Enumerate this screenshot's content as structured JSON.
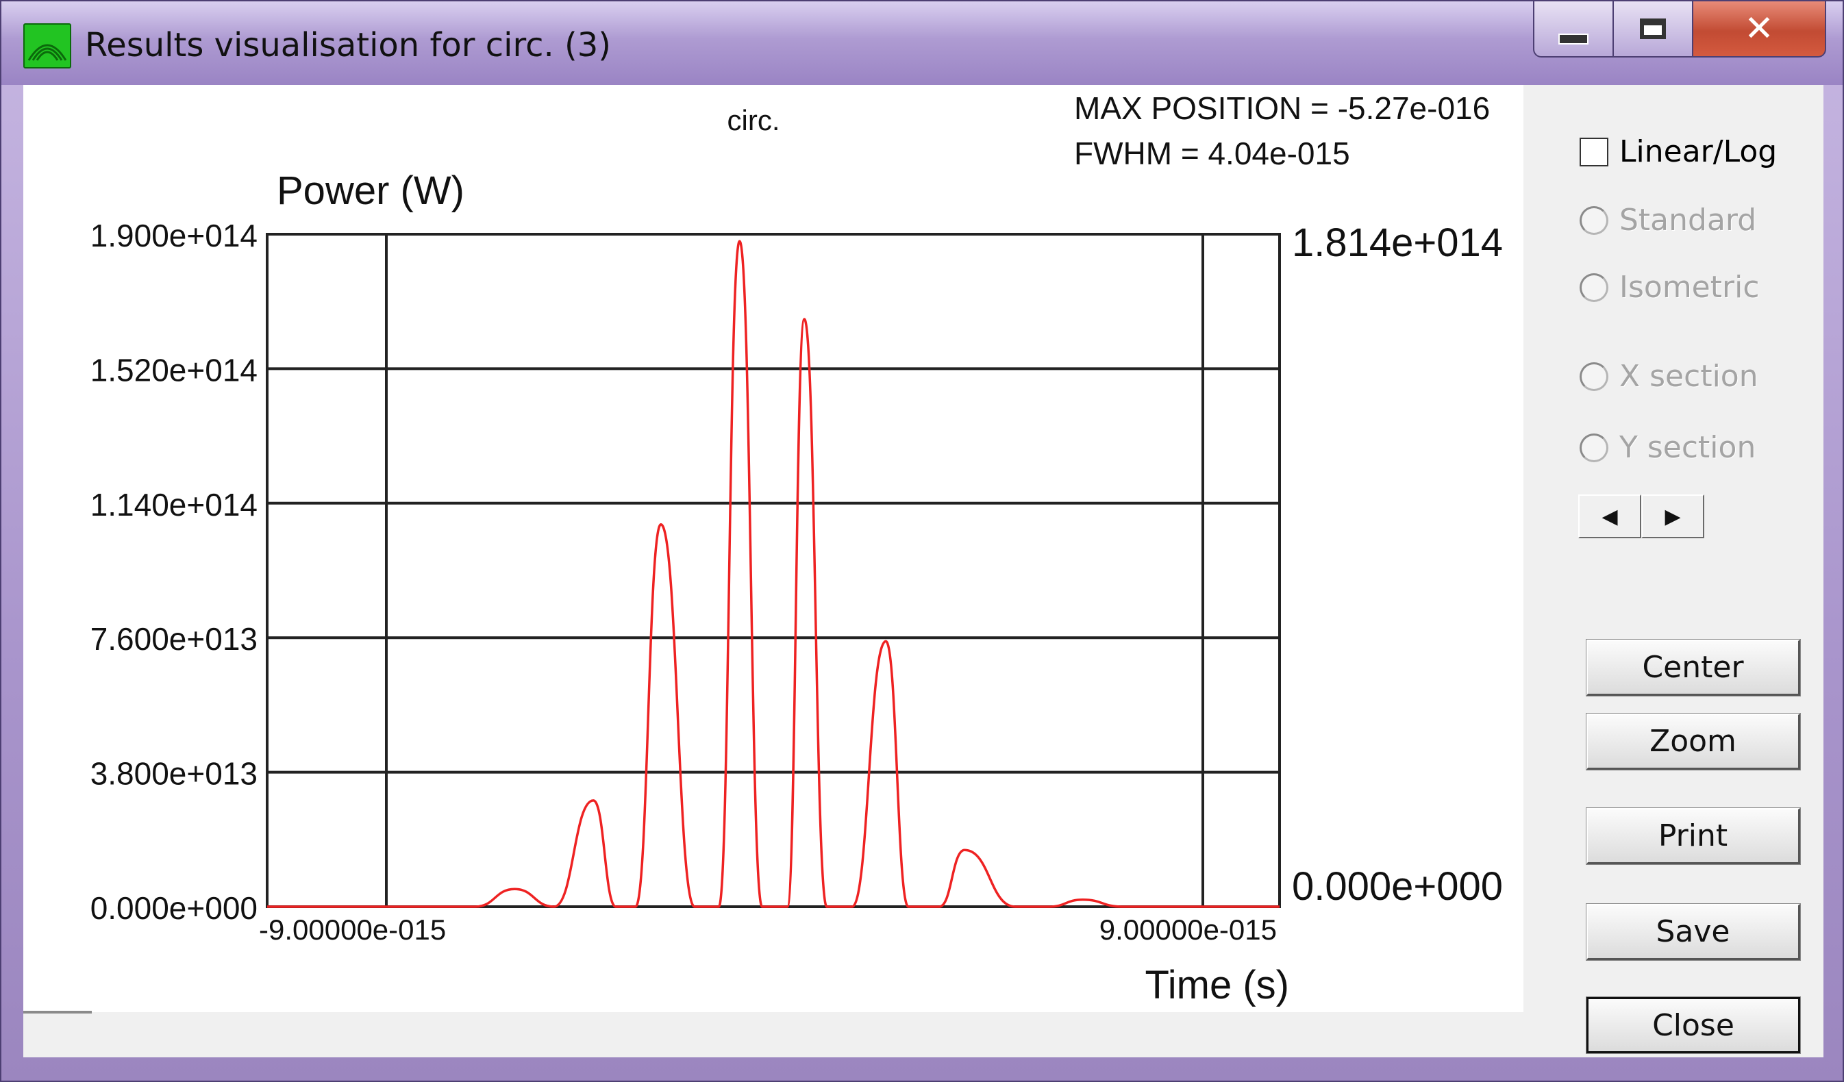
{
  "window": {
    "title": "Results visualisation for circ. (3)",
    "close_glyph": "✕"
  },
  "chart_info": {
    "max_position": "MAX POSITION = -5.27e-016",
    "fwhm": "FWHM = 4.04e-015"
  },
  "right_axis": {
    "max_label": "1.814e+014",
    "min_label": "0.000e+000"
  },
  "controls": {
    "linear_log_label": "Linear/Log",
    "standard_label": "Standard",
    "isometric_label": "Isometric",
    "x_section_label": "X section",
    "y_section_label": "Y section",
    "prev_glyph": "◀",
    "next_glyph": "▶",
    "center_label": "Center",
    "zoom_label": "Zoom",
    "print_label": "Print",
    "save_label": "Save",
    "close_label": "Close"
  },
  "colors": {
    "series": "#ee2222",
    "grid": "#222222",
    "icon": "#22c422"
  },
  "icons": {
    "app": "app-icon",
    "minimize": "minimize-icon",
    "maximize": "maximize-icon",
    "close": "close-icon"
  },
  "chart_data": {
    "type": "line",
    "title": "circ.",
    "xlabel": "Time (s)",
    "ylabel": "Power (W)",
    "xlim": [
      -9e-15,
      9e-15
    ],
    "ylim": [
      0,
      190000000000000.0
    ],
    "y_ticks": [
      0,
      38000000000000.0,
      76000000000000.0,
      114000000000000.0,
      152000000000000.0,
      190000000000000.0
    ],
    "y_tick_labels": [
      "0.000e+000",
      "3.800e+013",
      "7.600e+013",
      "1.140e+014",
      "1.520e+014",
      "1.900e+014"
    ],
    "x_tick_labels": [
      "-9.00000e-015",
      "9.00000e-015"
    ],
    "grid": true,
    "series": [
      {
        "x": [
          -9e-15,
          -6.8e-15,
          -5.3e-15,
          -4.6e-15,
          -3.9e-15,
          -3.2e-15,
          -2.8e-15,
          -2.45e-15,
          -2e-15,
          -1.4e-15,
          -9.7e-16,
          -6e-16,
          -2e-16,
          2.5e-16,
          5.5e-16,
          9.5e-16,
          1.4e-15,
          2e-15,
          2.4e-15,
          2.95e-15,
          3.4e-15,
          4.3e-15,
          4.9e-15,
          5.5e-15,
          6.2e-15,
          9e-15
        ],
        "y": [
          0,
          0,
          0,
          5000000000000.0,
          0,
          30000000000000.0,
          0,
          0,
          108000000000000.0,
          0,
          0,
          188000000000000.0,
          0,
          0,
          166000000000000.0,
          0,
          0,
          75000000000000.0,
          0,
          0,
          16000000000000.0,
          0,
          0,
          2000000000000.0,
          0,
          0
        ]
      }
    ]
  }
}
